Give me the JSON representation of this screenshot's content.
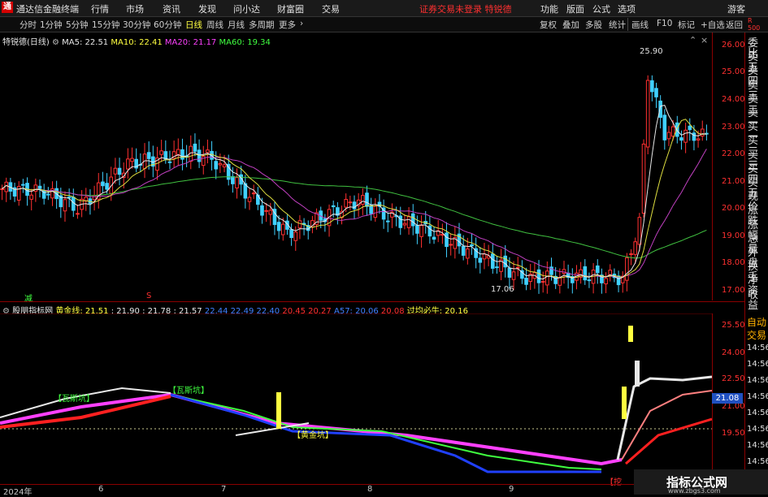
{
  "app": {
    "title": "通达信金融终端",
    "menu": [
      "行情",
      "市场",
      "资讯",
      "发现",
      "问小达",
      "财富圈",
      "交易"
    ],
    "notice": "证券交易未登录  特锐德",
    "menu_right": [
      "功能",
      "版面",
      "公式",
      "选项"
    ],
    "guest": "游客"
  },
  "toolbar": {
    "periods": [
      "分时",
      "1分钟",
      "5分钟",
      "15分钟",
      "30分钟",
      "60分钟",
      "日线",
      "周线",
      "月线",
      "多周期",
      "更多"
    ],
    "active_period": "日线",
    "right_buttons": [
      "复权",
      "叠加",
      "多股",
      "统计",
      "画线",
      "F10",
      "标记",
      "+自选",
      "返回"
    ]
  },
  "stock": {
    "name": "特锐德(日线)"
  },
  "ma_legend": [
    {
      "label": "MA5: 22.51",
      "color": "#e8e8e8"
    },
    {
      "label": "MA10: 22.41",
      "color": "#ffff40"
    },
    {
      "label": "MA20: 21.17",
      "color": "#ff40ff"
    },
    {
      "label": "MA60: 19.34",
      "color": "#40ff40"
    }
  ],
  "price_axis": [
    "26.00",
    "25.00",
    "24.00",
    "23.00",
    "22.00",
    "21.00",
    "20.00",
    "19.00",
    "18.00",
    "17.00"
  ],
  "annotations": {
    "high": "25.90",
    "low": "17.06",
    "reduce": "减",
    "s_mark": "S"
  },
  "indicator": {
    "name": "股朋指标网",
    "values": [
      {
        "label": "黄金线: 21.51",
        "color": "#ffff40"
      },
      {
        "label": ": 21.90",
        "color": "#e8e8e8"
      },
      {
        "label": ": 21.78",
        "color": "#e8e8e8"
      },
      {
        "label": ": 21.57",
        "color": "#e8e8e8"
      },
      {
        "label": "22.44",
        "color": "#4080ff"
      },
      {
        "label": "22.49",
        "color": "#4080ff"
      },
      {
        "label": "22.40",
        "color": "#4080ff"
      },
      {
        "label": "20.45",
        "color": "#ff3030"
      },
      {
        "label": "20.27",
        "color": "#ff3030"
      },
      {
        "label": "A57: 20.06",
        "color": "#4080ff"
      },
      {
        "label": "20.08",
        "color": "#ff3030"
      },
      {
        "label": "过均必牛: 20.16",
        "color": "#ffff40"
      }
    ],
    "axis": [
      "25.50",
      "24.00",
      "22.50",
      "21.00",
      "19.50"
    ],
    "current": "21.08",
    "labels": {
      "wasi": "【瓦斯坑】",
      "wasi2": "【瓦斯坑】",
      "gold": "【黄金坑】",
      "dig": "【挖"
    }
  },
  "side_panel": [
    "委比",
    "卖五",
    "卖四",
    "卖三",
    "卖二",
    "卖一",
    "买一",
    "买二",
    "买三",
    "买四",
    "买五",
    "现价",
    "涨跌",
    "涨幅",
    "总量",
    "外盘",
    "换手",
    "净资",
    "收益"
  ],
  "sub_side": [
    "自动",
    "交易",
    "14:56",
    "14:56",
    "14:56",
    "14:56",
    "14:56",
    "14:56",
    "14:56",
    "14:56",
    "14:56"
  ],
  "r_label": "R\n500",
  "xaxis": [
    "2024年",
    "6",
    "7",
    "8",
    "9"
  ],
  "watermark": {
    "title": "指标公式网",
    "url": "www.zbgs3.com"
  },
  "chart_data": {
    "type": "candlestick",
    "title": "特锐德(日线)",
    "y_range": [
      16.7,
      26.3
    ],
    "note_high": 25.9,
    "note_low": 17.06
  }
}
